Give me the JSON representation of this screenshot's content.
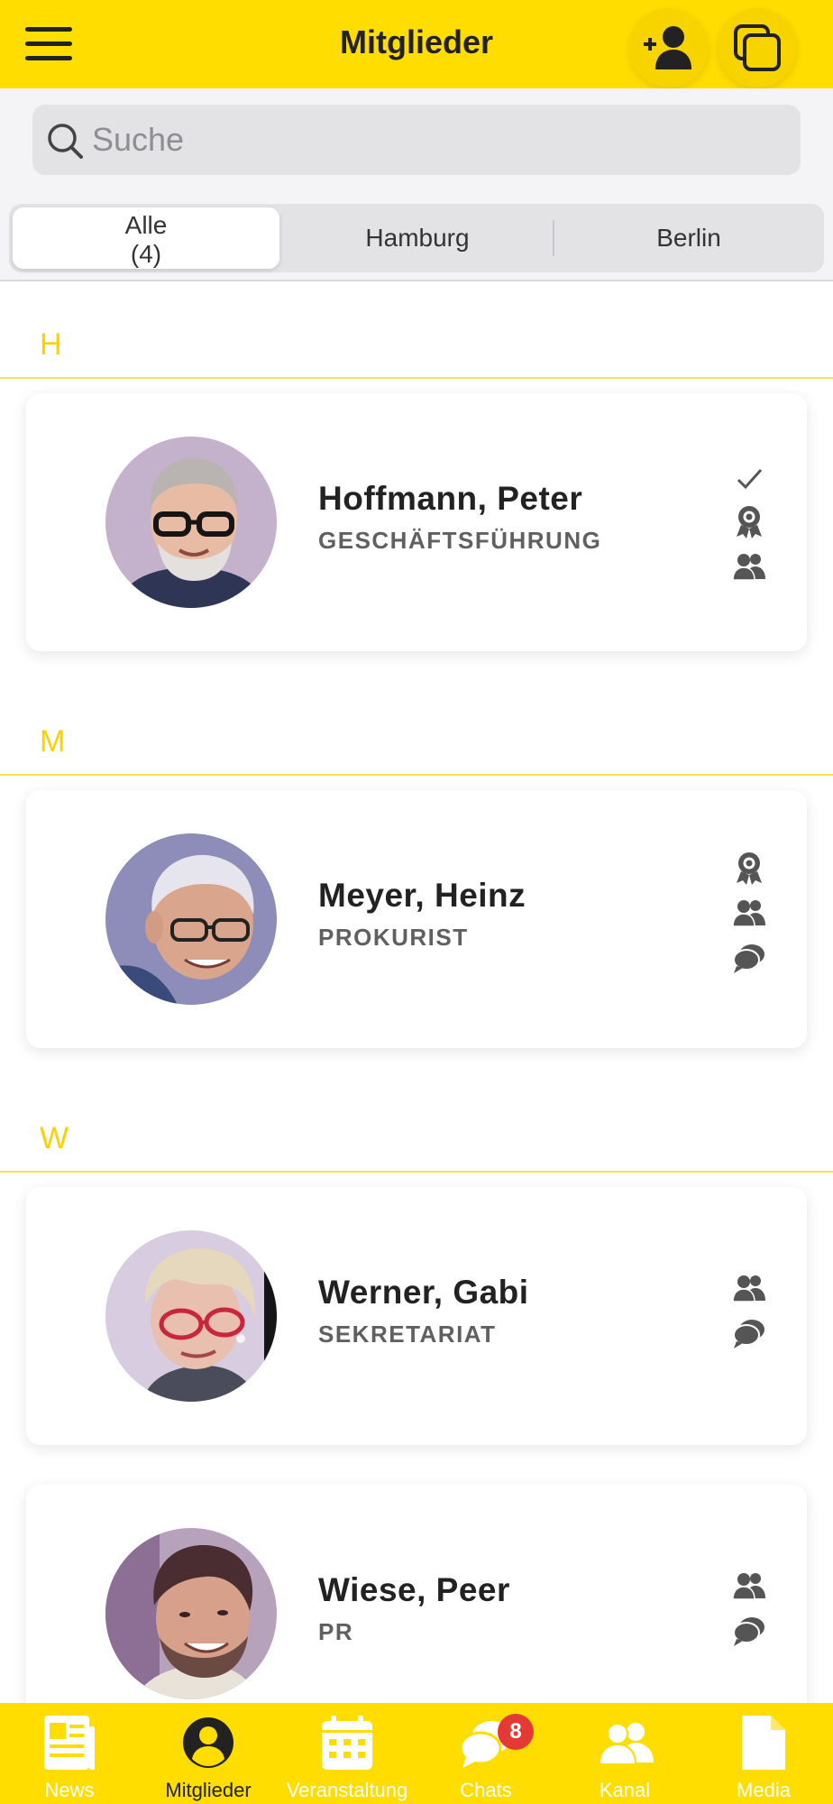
{
  "header": {
    "title": "Mitglieder",
    "menu_icon": "hamburger-icon",
    "add_member_icon": "add-user-icon",
    "copy_icon": "copy-icon"
  },
  "search": {
    "placeholder": "Suche",
    "icon": "search-icon"
  },
  "filters": {
    "tabs": [
      {
        "label": "Alle",
        "count": "(4)",
        "selected": true
      },
      {
        "label": "Hamburg",
        "selected": false
      },
      {
        "label": "Berlin",
        "selected": false
      }
    ]
  },
  "sections": [
    {
      "letter": "H",
      "members": [
        {
          "name": "Hoffmann, Peter",
          "role": "GESCHÄFTSFÜHRUNG",
          "status_icons": [
            "check-icon",
            "award-icon",
            "group-icon"
          ]
        }
      ]
    },
    {
      "letter": "M",
      "members": [
        {
          "name": "Meyer, Heinz",
          "role": "PROKURIST",
          "status_icons": [
            "award-icon",
            "group-icon",
            "chat-icon"
          ]
        }
      ]
    },
    {
      "letter": "W",
      "members": [
        {
          "name": "Werner, Gabi",
          "role": "SEKRETARIAT",
          "status_icons": [
            "group-icon",
            "chat-icon"
          ]
        },
        {
          "name": "Wiese, Peer",
          "role": "PR",
          "status_icons": [
            "group-icon",
            "chat-icon"
          ]
        }
      ]
    }
  ],
  "bottom_nav": {
    "items": [
      {
        "label": "News",
        "icon": "news-icon",
        "active": false
      },
      {
        "label": "Mitglieder",
        "icon": "person-icon",
        "active": true
      },
      {
        "label": "Veranstaltung",
        "icon": "calendar-icon",
        "active": false
      },
      {
        "label": "Chats",
        "icon": "chat-bubbles-icon",
        "active": false,
        "badge": "8"
      },
      {
        "label": "Kanal",
        "icon": "group-icon",
        "active": false
      },
      {
        "label": "Media",
        "icon": "file-icon",
        "active": false
      }
    ]
  },
  "colors": {
    "brand_yellow": "#FFDD00",
    "section_letter": "#FFD000",
    "badge_red": "#E53935",
    "nav_inactive_label": "#FFFFFF"
  }
}
